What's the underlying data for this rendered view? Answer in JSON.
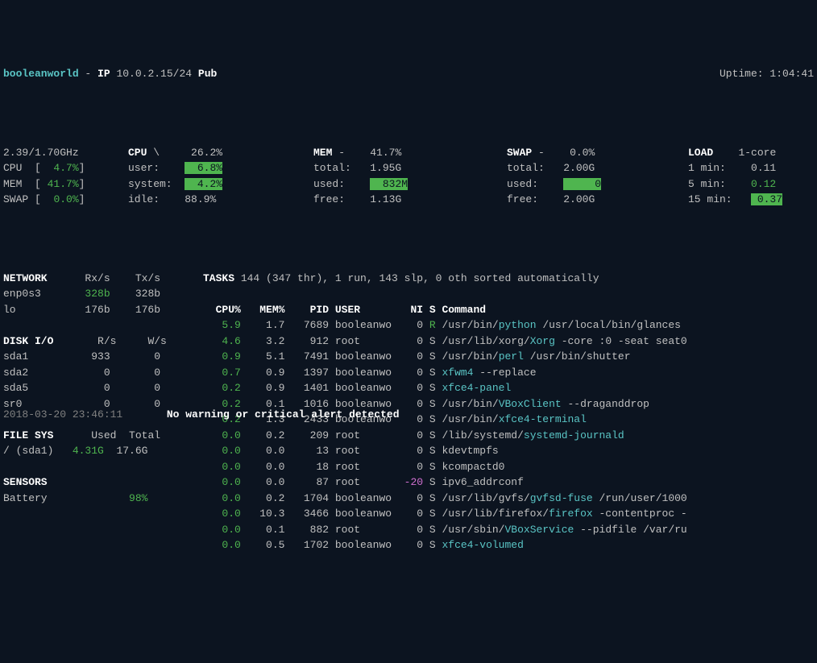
{
  "header": {
    "hostname": "booleanworld",
    "ip_label": "IP",
    "ip": "10.0.2.15/24",
    "pub_label": "Pub",
    "uptime_label": "Uptime:",
    "uptime": "1:04:41"
  },
  "quickstats": {
    "freq": "2.39/1.70GHz",
    "cpu_label": "CPU",
    "cpu_pct": "4.7%",
    "mem_label": "MEM",
    "mem_pct": "41.7%",
    "swap_label": "SWAP",
    "swap_pct": "0.0%"
  },
  "cpu": {
    "title": "CPU",
    "indicator": "\\",
    "total": "26.2%",
    "user_label": "user:",
    "user": "6.8%",
    "system_label": "system:",
    "system": "4.2%",
    "idle_label": "idle:",
    "idle": "88.9%"
  },
  "mem": {
    "title": "MEM",
    "indicator": "-",
    "pct": "41.7%",
    "total_label": "total:",
    "total": "1.95G",
    "used_label": "used:",
    "used": "832M",
    "free_label": "free:",
    "free": "1.13G"
  },
  "swap": {
    "title": "SWAP",
    "indicator": "-",
    "pct": "0.0%",
    "total_label": "total:",
    "total": "2.00G",
    "used_label": "used:",
    "used": "0",
    "free_label": "free:",
    "free": "2.00G"
  },
  "load": {
    "title": "LOAD",
    "cores": "1-core",
    "min1_label": "1 min:",
    "min1": "0.11",
    "min5_label": "5 min:",
    "min5": "0.12",
    "min15_label": "15 min:",
    "min15": "0.37"
  },
  "network": {
    "title": "NETWORK",
    "rx": "Rx/s",
    "tx": "Tx/s",
    "ifaces": [
      {
        "name": "enp0s3",
        "rx": "328b",
        "tx": "328b",
        "rx_green": true
      },
      {
        "name": "lo",
        "rx": "176b",
        "tx": "176b"
      }
    ]
  },
  "diskio": {
    "title": "DISK I/O",
    "r": "R/s",
    "w": "W/s",
    "disks": [
      {
        "name": "sda1",
        "r": "933",
        "w": "0"
      },
      {
        "name": "sda2",
        "r": "0",
        "w": "0"
      },
      {
        "name": "sda5",
        "r": "0",
        "w": "0"
      },
      {
        "name": "sr0",
        "r": "0",
        "w": "0"
      }
    ]
  },
  "filesys": {
    "title": "FILE SYS",
    "used_label": "Used",
    "total_label": "Total",
    "rows": [
      {
        "name": "/ (sda1)",
        "used": "4.31G",
        "total": "17.6G"
      }
    ]
  },
  "sensors": {
    "title": "SENSORS",
    "rows": [
      {
        "name": "Battery",
        "value": "98%"
      }
    ]
  },
  "tasks": {
    "title": "TASKS",
    "summary": "144 (347 thr), 1 run, 143 slp, 0 oth sorted automatically",
    "headers": {
      "cpu": "CPU%",
      "mem": "MEM%",
      "pid": "PID",
      "user": "USER",
      "ni": "NI",
      "s": "S",
      "cmd": "Command"
    }
  },
  "procs": [
    {
      "cpu": "5.9",
      "mem": "1.7",
      "pid": "7689",
      "user": "booleanwo",
      "ni": "0",
      "s": "R",
      "scolor": "green",
      "cmd": [
        {
          "t": "/usr/bin/"
        },
        {
          "t": "python",
          "c": "cyan"
        },
        {
          "t": " /usr/local/bin/glances"
        }
      ]
    },
    {
      "cpu": "4.6",
      "mem": "3.2",
      "pid": "912",
      "user": "root",
      "ni": "0",
      "s": "S",
      "cmd": [
        {
          "t": "/usr/lib/xorg/"
        },
        {
          "t": "Xorg",
          "c": "cyan"
        },
        {
          "t": " -core :0 -seat seat0"
        }
      ]
    },
    {
      "cpu": "0.9",
      "mem": "5.1",
      "pid": "7491",
      "user": "booleanwo",
      "ni": "0",
      "s": "S",
      "cmd": [
        {
          "t": "/usr/bin/"
        },
        {
          "t": "perl",
          "c": "cyan"
        },
        {
          "t": " /usr/bin/shutter"
        }
      ]
    },
    {
      "cpu": "0.7",
      "mem": "0.9",
      "pid": "1397",
      "user": "booleanwo",
      "ni": "0",
      "s": "S",
      "cmd": [
        {
          "t": "xfwm4",
          "c": "cyan"
        },
        {
          "t": " --replace"
        }
      ]
    },
    {
      "cpu": "0.2",
      "mem": "0.9",
      "pid": "1401",
      "user": "booleanwo",
      "ni": "0",
      "s": "S",
      "cmd": [
        {
          "t": "xfce4-panel",
          "c": "cyan"
        }
      ]
    },
    {
      "cpu": "0.2",
      "mem": "0.1",
      "pid": "1016",
      "user": "booleanwo",
      "ni": "0",
      "s": "S",
      "cmd": [
        {
          "t": "/usr/bin/"
        },
        {
          "t": "VBoxClient",
          "c": "cyan"
        },
        {
          "t": " --draganddrop"
        }
      ]
    },
    {
      "cpu": "0.2",
      "mem": "1.3",
      "pid": "2433",
      "user": "booleanwo",
      "ni": "0",
      "s": "S",
      "cmd": [
        {
          "t": "/usr/bin/"
        },
        {
          "t": "xfce4-terminal",
          "c": "cyan"
        }
      ]
    },
    {
      "cpu": "0.0",
      "mem": "0.2",
      "pid": "209",
      "user": "root",
      "ni": "0",
      "s": "S",
      "cmd": [
        {
          "t": "/lib/systemd/"
        },
        {
          "t": "systemd-journald",
          "c": "cyan"
        }
      ]
    },
    {
      "cpu": "0.0",
      "mem": "0.0",
      "pid": "13",
      "user": "root",
      "ni": "0",
      "s": "S",
      "cmd": [
        {
          "t": "kdevtmpfs"
        }
      ]
    },
    {
      "cpu": "0.0",
      "mem": "0.0",
      "pid": "18",
      "user": "root",
      "ni": "0",
      "s": "S",
      "cmd": [
        {
          "t": "kcompactd0"
        }
      ]
    },
    {
      "cpu": "0.0",
      "mem": "0.0",
      "pid": "87",
      "user": "root",
      "ni": "-20",
      "nicolor": "magenta",
      "s": "S",
      "cmd": [
        {
          "t": "ipv6_addrconf"
        }
      ]
    },
    {
      "cpu": "0.0",
      "mem": "0.2",
      "pid": "1704",
      "user": "booleanwo",
      "ni": "0",
      "s": "S",
      "cmd": [
        {
          "t": "/usr/lib/gvfs/"
        },
        {
          "t": "gvfsd-fuse",
          "c": "cyan"
        },
        {
          "t": " /run/user/1000"
        }
      ]
    },
    {
      "cpu": "0.0",
      "mem": "10.3",
      "pid": "3466",
      "user": "booleanwo",
      "ni": "0",
      "s": "S",
      "cmd": [
        {
          "t": "/usr/lib/firefox/"
        },
        {
          "t": "firefox",
          "c": "cyan"
        },
        {
          "t": " -contentproc -"
        }
      ]
    },
    {
      "cpu": "0.0",
      "mem": "0.1",
      "pid": "882",
      "user": "root",
      "ni": "0",
      "s": "S",
      "cmd": [
        {
          "t": "/usr/sbin/"
        },
        {
          "t": "VBoxService",
          "c": "cyan"
        },
        {
          "t": " --pidfile /var/ru"
        }
      ]
    },
    {
      "cpu": "0.0",
      "mem": "0.5",
      "pid": "1702",
      "user": "booleanwo",
      "ni": "0",
      "s": "S",
      "cmd": [
        {
          "t": "xfce4-volumed",
          "c": "cyan"
        }
      ]
    }
  ],
  "footer": {
    "datetime": "2018-03-20 23:46:11",
    "alert": "No warning or critical alert detected"
  }
}
